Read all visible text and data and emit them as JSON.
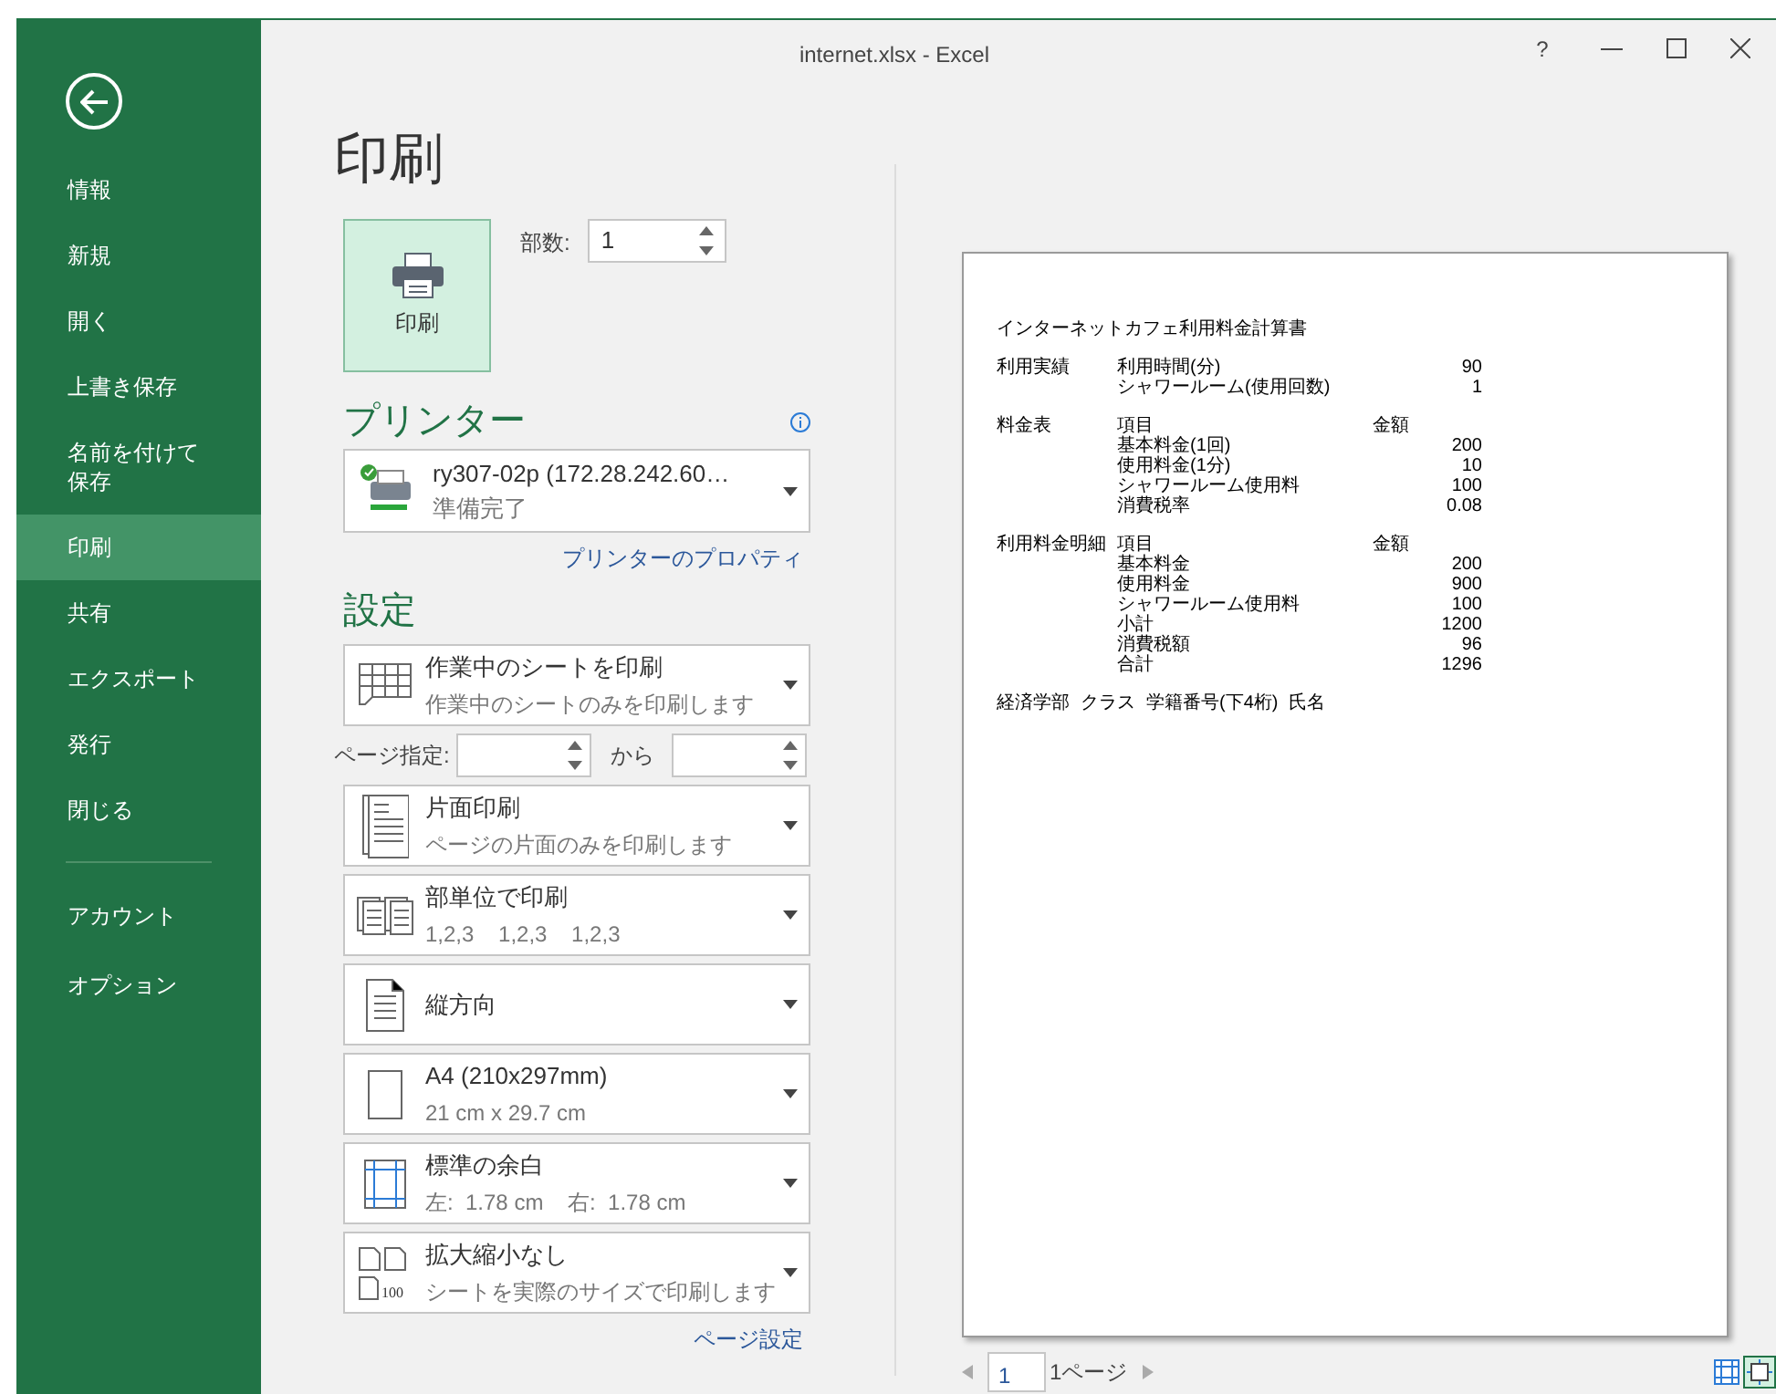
{
  "window": {
    "title": "internet.xlsx - Excel",
    "help": "?"
  },
  "sidebar": {
    "items": [
      {
        "label": "情報",
        "selected": false
      },
      {
        "label": "新規",
        "selected": false
      },
      {
        "label": "開く",
        "selected": false
      },
      {
        "label": "上書き保存",
        "selected": false
      },
      {
        "label": "名前を付けて保存",
        "selected": false
      },
      {
        "label": "印刷",
        "selected": true
      },
      {
        "label": "共有",
        "selected": false
      },
      {
        "label": "エクスポート",
        "selected": false
      },
      {
        "label": "発行",
        "selected": false
      },
      {
        "label": "閉じる",
        "selected": false
      }
    ],
    "bottom_items": [
      {
        "label": "アカウント",
        "selected": false
      },
      {
        "label": "オプション",
        "selected": false
      }
    ]
  },
  "heading": "印刷",
  "print_button": "印刷",
  "copies": {
    "label": "部数:",
    "value": "1"
  },
  "printer": {
    "heading": "プリンター",
    "name": "ry307-02p (172.28.242.60…",
    "status": "準備完了",
    "properties_link": "プリンターのプロパティ"
  },
  "settings": {
    "heading": "設定",
    "options": [
      {
        "kind": "sheets",
        "title": "作業中のシートを印刷",
        "subtitle": "作業中のシートのみを印刷します"
      },
      {
        "kind": "pages",
        "label": "ページ指定:",
        "to": "から"
      },
      {
        "kind": "one-sided",
        "title": "片面印刷",
        "subtitle": "ページの片面のみを印刷します"
      },
      {
        "kind": "collate",
        "title": "部単位で印刷",
        "subtitle": "1,2,3    1,2,3    1,2,3"
      },
      {
        "kind": "portrait",
        "title": "縦方向"
      },
      {
        "kind": "paper",
        "title": "A4 (210x297mm)",
        "subtitle": "21 cm x 29.7 cm"
      },
      {
        "kind": "margins",
        "title": "標準の余白",
        "subtitle": "左:  1.78 cm    右:  1.78 cm"
      },
      {
        "kind": "scaling",
        "title": "拡大縮小なし",
        "subtitle": "シートを実際のサイズで印刷します",
        "badge": "100"
      }
    ],
    "page_setup_link": "ページ設定"
  },
  "preview": {
    "title": "インターネットカフェ利用料金計算書",
    "sections": [
      {
        "label": "利用実績",
        "rows": [
          {
            "kind": "data",
            "item": "利用時間(分)",
            "value": "90"
          },
          {
            "kind": "data",
            "item": "シャワールーム(使用回数)",
            "value": "1"
          }
        ]
      },
      {
        "label": "料金表",
        "rows": [
          {
            "kind": "header",
            "item": "項目",
            "value": "金額"
          },
          {
            "kind": "data",
            "item": "基本料金(1回)",
            "value": "200"
          },
          {
            "kind": "data",
            "item": "使用料金(1分)",
            "value": "10"
          },
          {
            "kind": "data",
            "item": "シャワールーム使用料",
            "value": "100"
          },
          {
            "kind": "data",
            "item": "消費税率",
            "value": "0.08"
          }
        ]
      },
      {
        "label": "利用料金明細",
        "rows": [
          {
            "kind": "header",
            "item": "項目",
            "value": "金額"
          },
          {
            "kind": "data",
            "item": "基本料金",
            "value": "200"
          },
          {
            "kind": "data",
            "item": "使用料金",
            "value": "900"
          },
          {
            "kind": "data",
            "item": "シャワールーム使用料",
            "value": "100"
          },
          {
            "kind": "data",
            "item": "小計",
            "value": "1200"
          },
          {
            "kind": "data",
            "item": "消費税額",
            "value": "96"
          },
          {
            "kind": "data",
            "item": "合計",
            "value": "1296"
          }
        ]
      }
    ],
    "footer": [
      "経済学部",
      "クラス",
      "学籍番号(下4桁)",
      "氏名"
    ]
  },
  "pager": {
    "page": "1",
    "count": "1ページ"
  },
  "view_buttons": [
    {
      "kind": "margins",
      "selected": false
    },
    {
      "kind": "fit",
      "selected": true
    }
  ]
}
